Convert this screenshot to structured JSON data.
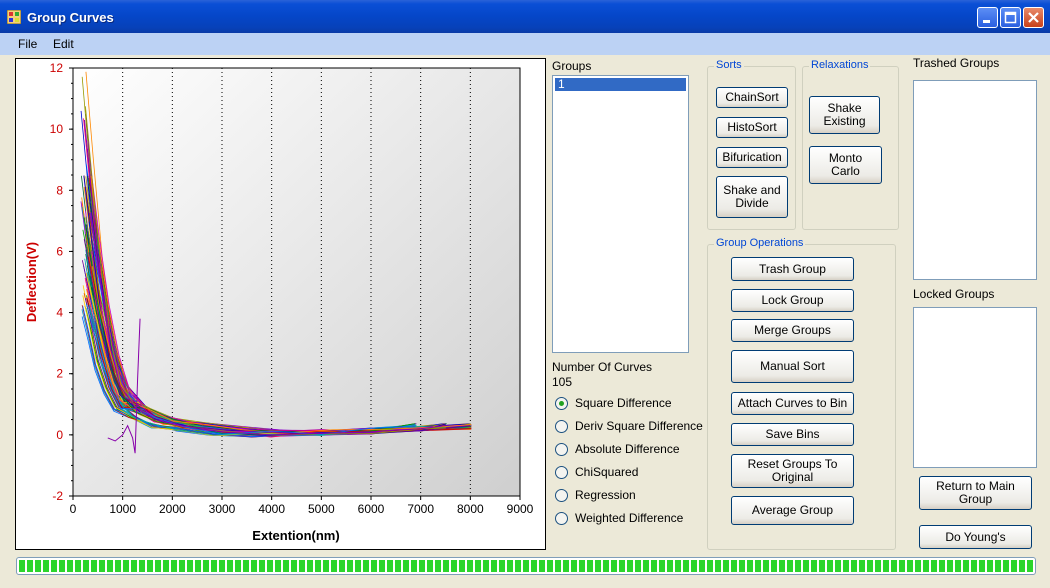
{
  "window": {
    "title": "Group Curves"
  },
  "menu": [
    "File",
    "Edit"
  ],
  "chart_data": {
    "type": "line",
    "xlabel": "Extention(nm)",
    "ylabel": "Deflection(V)",
    "xlim": [
      0,
      9000
    ],
    "ylim": [
      -2,
      12
    ],
    "x_ticks": [
      "0",
      "1000",
      "2000",
      "3000",
      "4000",
      "5000",
      "6000",
      "7000",
      "8000",
      "9000"
    ],
    "y_ticks": [
      "-2",
      "0",
      "2",
      "4",
      "6",
      "8",
      "10",
      "12"
    ],
    "grid": "vertical dotted",
    "series_count": 105,
    "representative_series": [
      {
        "x": [
          250,
          400,
          600,
          800,
          1000,
          1300,
          1700,
          2200,
          3000,
          4000,
          5000,
          6000,
          7000,
          8000
        ],
        "y": [
          7.5,
          6.0,
          4.0,
          2.4,
          1.5,
          1.0,
          0.6,
          0.35,
          0.15,
          0.05,
          0.05,
          0.1,
          0.2,
          0.25
        ]
      },
      {
        "x": [
          230,
          380,
          560,
          760,
          950,
          1250,
          1650,
          2200,
          3000,
          4000,
          5000,
          6000,
          7000,
          7500
        ],
        "y": [
          10.3,
          7.8,
          5.0,
          2.8,
          1.6,
          0.9,
          0.5,
          0.3,
          0.1,
          0.0,
          0.05,
          0.1,
          0.2,
          0.3
        ]
      },
      {
        "x": [
          280,
          420,
          600,
          780,
          980,
          1300,
          1700,
          2300,
          3000,
          4000,
          5000,
          6000,
          6900
        ],
        "y": [
          6.0,
          4.8,
          3.3,
          2.0,
          1.2,
          0.8,
          0.5,
          0.3,
          0.1,
          0.05,
          0.05,
          0.15,
          0.3
        ]
      },
      {
        "x": [
          300,
          450,
          650,
          850,
          1050,
          1400,
          1800,
          2400,
          3200,
          4000,
          5000,
          6000,
          7000,
          8000
        ],
        "y": [
          7.2,
          5.5,
          3.6,
          2.2,
          1.3,
          0.7,
          0.4,
          0.25,
          0.1,
          0.05,
          0.1,
          0.15,
          0.2,
          0.3
        ]
      },
      {
        "x": [
          260,
          380,
          520,
          700,
          900,
          1200,
          1600,
          2100,
          2800,
          3600,
          4500,
          5500
        ],
        "y": [
          5.5,
          4.4,
          3.0,
          1.9,
          1.1,
          0.6,
          0.3,
          0.2,
          0.05,
          0.0,
          0.05,
          0.1
        ]
      },
      {
        "x": [
          320,
          480,
          700,
          900,
          1100,
          1500,
          2000,
          2600,
          3400,
          4200,
          5200,
          6200,
          7200,
          8000
        ],
        "y": [
          6.8,
          5.0,
          3.2,
          2.0,
          1.3,
          0.8,
          0.5,
          0.35,
          0.2,
          0.1,
          0.1,
          0.15,
          0.25,
          0.3
        ]
      },
      {
        "x": [
          700,
          850,
          1000,
          1100,
          1200,
          1250,
          1300,
          1350
        ],
        "y": [
          -0.1,
          -0.2,
          0.0,
          0.3,
          -0.1,
          -0.6,
          1.8,
          3.8
        ]
      }
    ]
  },
  "groups": {
    "label": "Groups",
    "items": [
      "1"
    ]
  },
  "curves": {
    "label": "Number Of Curves",
    "count": "105"
  },
  "metrics": [
    {
      "label": "Square Difference",
      "selected": true
    },
    {
      "label": "Deriv Square Difference",
      "selected": false
    },
    {
      "label": "Absolute Difference",
      "selected": false
    },
    {
      "label": "ChiSquared",
      "selected": false
    },
    {
      "label": "Regression",
      "selected": false
    },
    {
      "label": "Weighted Difference",
      "selected": false
    }
  ],
  "sorts": {
    "title": "Sorts",
    "chainsort": "ChainSort",
    "histosort": "HistoSort",
    "bifurication": "Bifurication",
    "shake_divide": "Shake and Divide"
  },
  "relaxations": {
    "title": "Relaxations",
    "shake_existing": "Shake Existing",
    "monte_carlo": "Monto Carlo"
  },
  "group_ops": {
    "title": "Group Operations",
    "trash": "Trash Group",
    "lock": "Lock Group",
    "merge": "Merge Groups",
    "manual_sort": "Manual Sort",
    "attach": "Attach Curves to Bin",
    "save_bins": "Save Bins",
    "reset": "Reset Groups To Original",
    "average": "Average Group"
  },
  "trashed": {
    "label": "Trashed Groups"
  },
  "locked": {
    "label": "Locked Groups"
  },
  "return_btn": "Return to Main Group",
  "youngs_btn": "Do Young's",
  "progress": {
    "value": 1.0
  },
  "colors": {
    "axis_label": "#cc0000",
    "accent": "#0046d5",
    "progress": "#2bd52b"
  }
}
